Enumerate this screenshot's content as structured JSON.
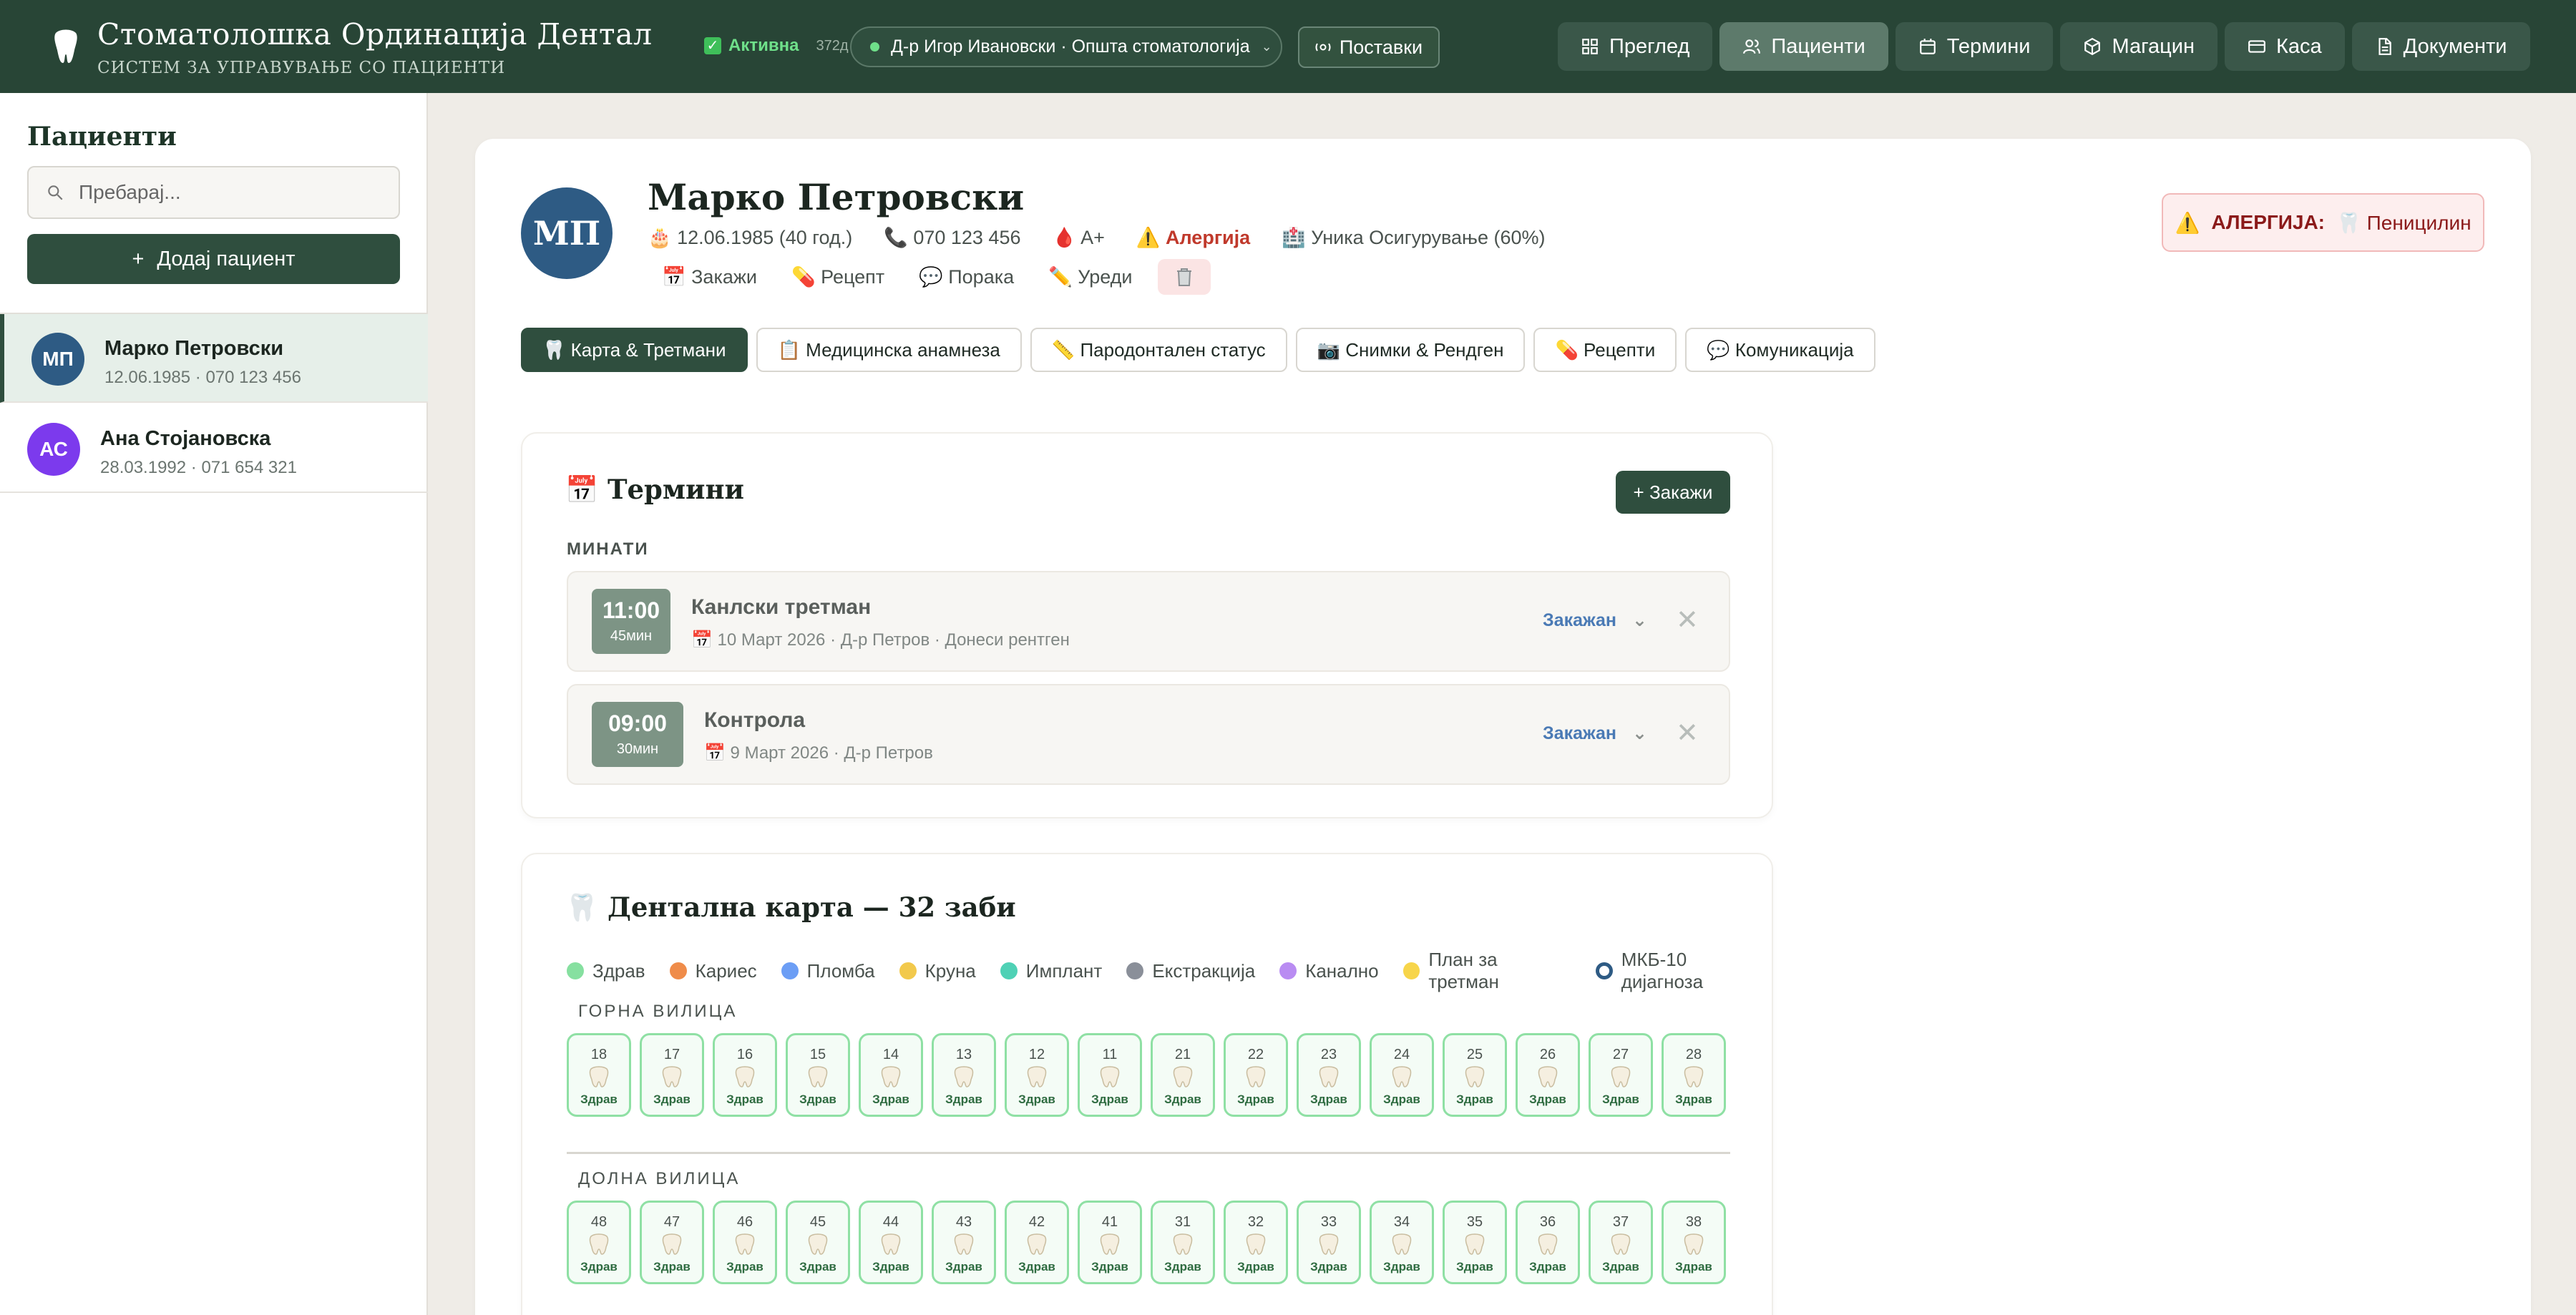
{
  "app": {
    "title": "Стоматолошка Ординација Дентал",
    "subtitle": "СИСТЕМ ЗА УПРАВУВАЊЕ СО ПАЦИЕНТИ",
    "status_label": "Активна",
    "status_days": "372д",
    "doctor": "Д-р Игор Ивановски · Општа стоматологија",
    "settings_label": "Поставки"
  },
  "nav": [
    {
      "label": "Преглед",
      "icon": "grid-icon"
    },
    {
      "label": "Пациенти",
      "icon": "users-icon"
    },
    {
      "label": "Термини",
      "icon": "calendar-icon"
    },
    {
      "label": "Магацин",
      "icon": "box-icon"
    },
    {
      "label": "Каса",
      "icon": "card-icon"
    },
    {
      "label": "Документи",
      "icon": "document-icon"
    }
  ],
  "sidebar": {
    "title": "Пациенти",
    "search_placeholder": "Пребарај...",
    "add_label": "Додај пациент",
    "patients": [
      {
        "initials": "МП",
        "name": "Марко Петровски",
        "meta": "12.06.1985 · 070 123 456",
        "color": "#2e5b84"
      },
      {
        "initials": "АС",
        "name": "Ана Стојановска",
        "meta": "28.03.1992 · 071 654 321",
        "color": "#7c3aed"
      }
    ]
  },
  "patient": {
    "initials": "МП",
    "name": "Марко Петровски",
    "dob": "🎂 12.06.1985 (40 год.)",
    "phone": "📞 070 123 456",
    "blood": "🩸 A+",
    "allergy_flag": "⚠️ Алергија",
    "insurance": "🏥 Уника Осигурување (60%)",
    "actions": [
      "📅 Закажи",
      "💊 Рецепт",
      "💬 Порака",
      "✏️ Уреди"
    ],
    "allergy_label": "АЛЕРГИЈА:",
    "allergy_value": "🦷 Пеницилин"
  },
  "tabs": [
    "🦷 Карта & Третмани",
    "📋 Медицинска анамнеза",
    "📏 Пародонтален статус",
    "📷 Снимки & Рендген",
    "💊 Рецепти",
    "💬 Комуникација"
  ],
  "appointments": {
    "title": "📅 Термини",
    "book_label": "+ Закажи",
    "past_label": "МИНАТИ",
    "items": [
      {
        "time": "11:00",
        "duration": "45мин",
        "title": "Канлски третман",
        "meta": "📅 10 Март 2026 · Д-р Петров · Донеси рентген",
        "status": "Закажан"
      },
      {
        "time": "09:00",
        "duration": "30мин",
        "title": "Контрола",
        "meta": "📅 9 Март 2026 · Д-р Петров",
        "status": "Закажан"
      }
    ]
  },
  "dental_chart": {
    "title": "🦷 Дентална карта — 32 заби",
    "legend": [
      {
        "label": "Здрав",
        "color": "#86e0a0"
      },
      {
        "label": "Кариес",
        "color": "#ef8c4a"
      },
      {
        "label": "Пломба",
        "color": "#6c9ef5"
      },
      {
        "label": "Круна",
        "color": "#f2c94c"
      },
      {
        "label": "Имплант",
        "color": "#4fd1b5"
      },
      {
        "label": "Екстракција",
        "color": "#8a8f99"
      },
      {
        "label": "Канално",
        "color": "#b98cf2"
      },
      {
        "label": "План за третман",
        "color": "#f7d54a"
      },
      {
        "label": "МКБ-10 дијагноза",
        "color": "#2e5b84"
      }
    ],
    "upper_label": "ГОРНА ВИЛИЦА",
    "lower_label": "ДОЛНА ВИЛИЦА",
    "upper": [
      "18",
      "17",
      "16",
      "15",
      "14",
      "13",
      "12",
      "11",
      "21",
      "22",
      "23",
      "24",
      "25",
      "26",
      "27",
      "28"
    ],
    "lower": [
      "48",
      "47",
      "46",
      "45",
      "44",
      "43",
      "42",
      "41",
      "31",
      "32",
      "33",
      "34",
      "35",
      "36",
      "37",
      "38"
    ],
    "status": "Здрав"
  }
}
